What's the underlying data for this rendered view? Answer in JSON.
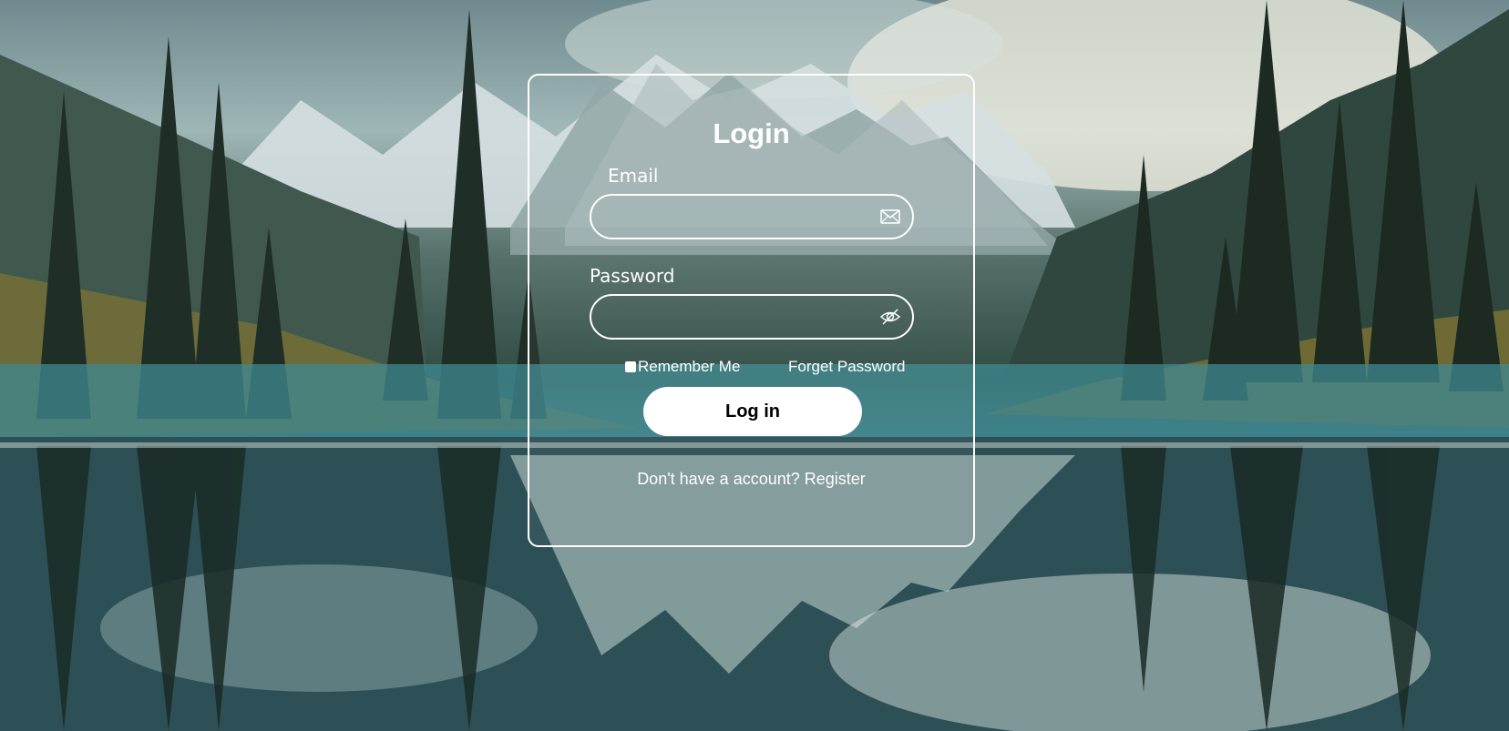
{
  "login": {
    "title": "Login",
    "email_label": "Email",
    "email_value": "",
    "password_label": "Password",
    "password_value": "",
    "remember_label": "Remember Me",
    "remember_checked": false,
    "forget_label": "Forget Password",
    "submit_label": "Log in",
    "register_prompt": "Don't have a account?",
    "register_link": "Register"
  },
  "icons": {
    "email": "mail-icon",
    "password": "eye-off-icon"
  },
  "colors": {
    "text": "#ffffff",
    "button_bg": "#ffffff",
    "button_text": "#000000"
  }
}
